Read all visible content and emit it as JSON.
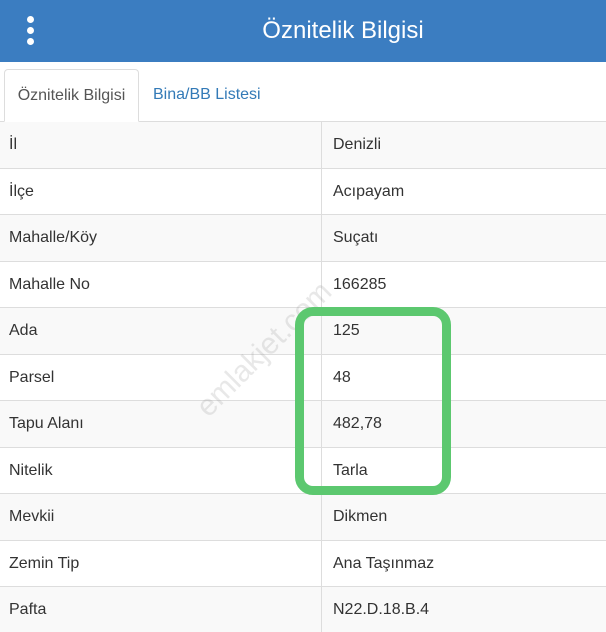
{
  "header": {
    "title": "Öznitelik Bilgisi",
    "menu_icon": "vertical-ellipsis-icon"
  },
  "tabs": [
    {
      "label": "Öznitelik Bilgisi",
      "active": true
    },
    {
      "label": "Bina/BB Listesi",
      "active": false
    }
  ],
  "rows": [
    {
      "label": "İl",
      "value": "Denizli"
    },
    {
      "label": "İlçe",
      "value": "Acıpayam"
    },
    {
      "label": "Mahalle/Köy",
      "value": "Suçatı"
    },
    {
      "label": "Mahalle No",
      "value": "166285"
    },
    {
      "label": "Ada",
      "value": "125"
    },
    {
      "label": "Parsel",
      "value": "48"
    },
    {
      "label": "Tapu Alanı",
      "value": "482,78"
    },
    {
      "label": "Nitelik",
      "value": "Tarla"
    },
    {
      "label": "Mevkii",
      "value": "Dikmen"
    },
    {
      "label": "Zemin Tip",
      "value": "Ana Taşınmaz"
    },
    {
      "label": "Pafta",
      "value": "N22.D.18.B.4"
    }
  ],
  "watermark": "emlakjet.com",
  "colors": {
    "header_bg": "#3b7dc1",
    "tab_link": "#337ab7",
    "highlight": "#5cc86f"
  }
}
